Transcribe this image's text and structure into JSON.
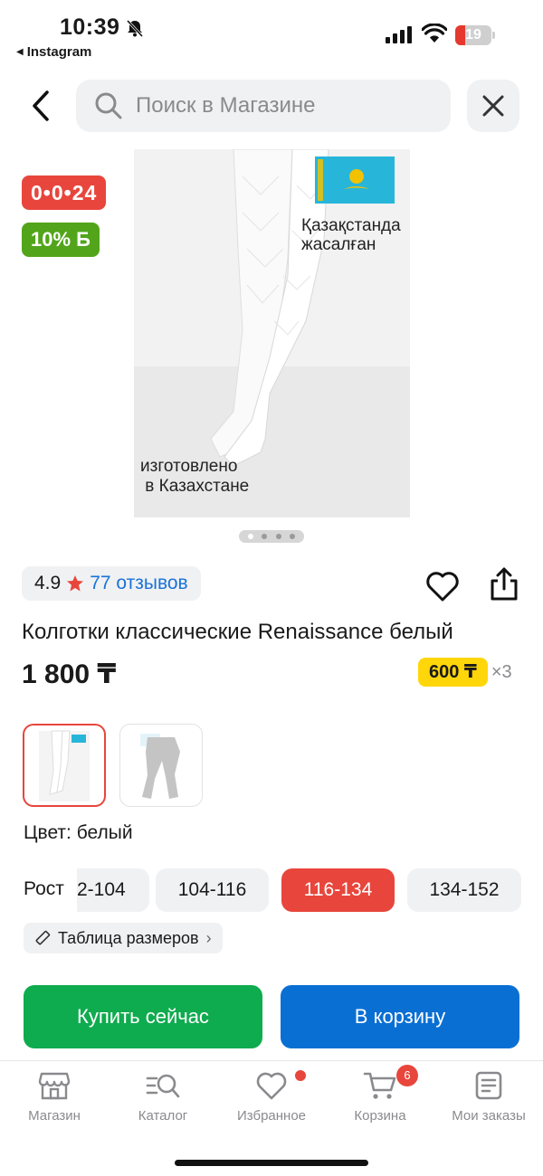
{
  "status_bar": {
    "time": "10:39",
    "back_app": "Instagram",
    "battery": "19"
  },
  "search": {
    "placeholder": "Поиск в Магазине"
  },
  "product": {
    "badge_timer": "0•0•24",
    "badge_bonus": "10% Б",
    "image_text_kz": "Қазақстанда жасалған",
    "image_text_ru": "изготовлено\n в Казахстане",
    "rating": "4.9",
    "reviews": "77 отзывов",
    "title": "Колготки классические Renaissance белый",
    "price": "1 800 ₸",
    "installment_price": "600 ₸",
    "installment_mult": "×3",
    "color_label": "Цвет: белый",
    "size_label": "Рост",
    "sizes": [
      "2-104",
      "104-116",
      "116-134",
      "134-152"
    ],
    "selected_size": "116-134",
    "size_table": "Таблица размеров"
  },
  "actions": {
    "buy_now": "Купить сейчас",
    "to_cart": "В корзину"
  },
  "tabbar": {
    "items": [
      {
        "label": "Магазин",
        "icon": "store-icon"
      },
      {
        "label": "Каталог",
        "icon": "catalog-search-icon"
      },
      {
        "label": "Избранное",
        "icon": "heart-icon"
      },
      {
        "label": "Корзина",
        "icon": "cart-icon",
        "badge": "6"
      },
      {
        "label": "Мои заказы",
        "icon": "orders-icon"
      }
    ]
  },
  "colors": {
    "accent_red": "#e8463c",
    "buy_green": "#0fab4f",
    "cart_blue": "#0a6fd3",
    "bonus_green": "#52a51a",
    "installment_yellow": "#ffd60a"
  }
}
